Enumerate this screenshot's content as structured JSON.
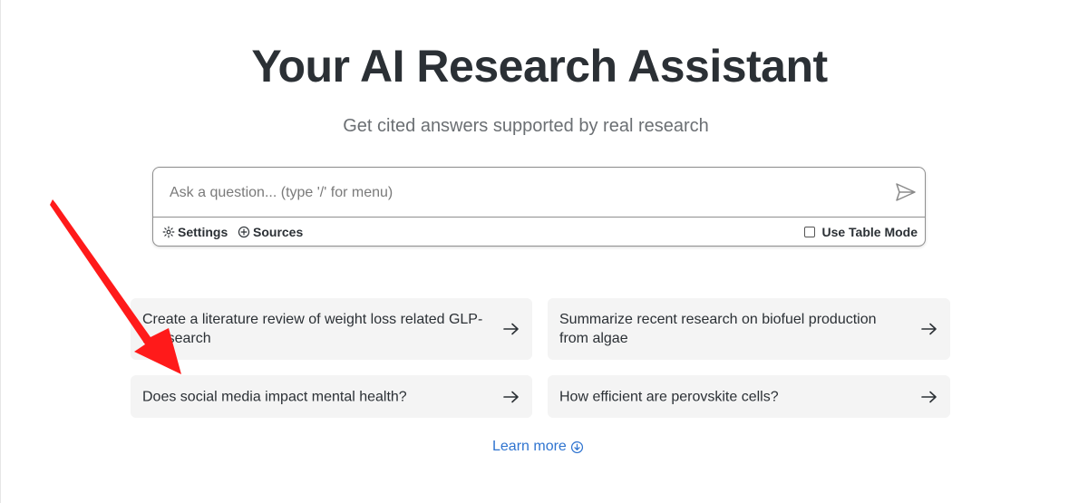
{
  "hero": {
    "title": "Your AI Research Assistant",
    "subtitle": "Get cited answers supported by real research"
  },
  "search": {
    "placeholder": "Ask a question... (type '/' for menu)",
    "value": "",
    "settings_label": "Settings",
    "sources_label": "Sources",
    "table_mode_label": "Use Table Mode",
    "table_mode_checked": false
  },
  "suggestions": [
    {
      "text": "Create a literature review of weight loss related GLP-1 research"
    },
    {
      "text": "Summarize recent research on biofuel production from algae"
    },
    {
      "text": "Does social media impact mental health?"
    },
    {
      "text": "How efficient are perovskite cells?"
    }
  ],
  "footer": {
    "learn_more_label": "Learn more"
  },
  "colors": {
    "text": "#2b3035",
    "subtle": "#6b6f73",
    "card_bg": "#f4f4f4",
    "link": "#2f74d0",
    "annotation_arrow": "#ff1a1a"
  },
  "icons": [
    "send-icon",
    "gear-icon",
    "plus-circle-icon",
    "arrow-right-icon",
    "arrow-down-circle-icon"
  ]
}
